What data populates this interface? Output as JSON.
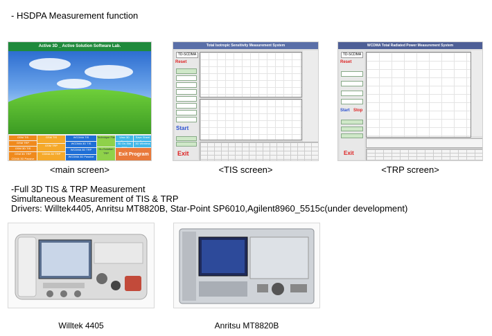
{
  "heading": "- HSDPA Measurement function",
  "screens": {
    "main": {
      "caption": "<main screen>",
      "title_bar": "Active 3D _ Active Solution Software Lab.",
      "buttons": [
        "GSM TIS",
        "GSM TRP",
        "GSM 3D TIS",
        "GSM 3D TRP",
        "CDMA 3D Passive",
        "GSM TIS",
        "GSM TRP",
        "CDMA 3D TRP",
        "WCDMA TIS",
        "WCDMA 3D TIS",
        "WCDMA 3D TRP",
        "WCDMA 3D Passive",
        "Technique File",
        "Hu-Solution TRP",
        "View 3D Graph",
        "3D On-Site TRP",
        "Save Sheet Data",
        "3D Wireless",
        "Exit Program"
      ]
    },
    "tis": {
      "caption": "<TIS screen>",
      "window_title": "Total Isotropic Sensitivity Measurement System",
      "mode": "TD-SCDMA",
      "reset_label": "Reset",
      "start_label": "Start",
      "exit_label": "Exit"
    },
    "trp": {
      "caption": "<TRP screen>",
      "window_title": "WCDMA Total Radiated Power Measurement  System",
      "mode": "TD-SCDMA",
      "reset_label": "Reset",
      "start_label": "Start",
      "stop_label": "Stop",
      "exit_label": "Exit"
    }
  },
  "features": {
    "line1": "-Full 3D TIS & TRP Measurement",
    "line2": "Simultaneous Measurement of TIS & TRP",
    "line3": "Drivers: Willtek4405, Anritsu MT8820B, Star-Point SP6010,Agilent8960_5515c(under development)"
  },
  "instruments": [
    {
      "caption": "Willtek 4405"
    },
    {
      "caption": "Anritsu MT8820B"
    }
  ]
}
